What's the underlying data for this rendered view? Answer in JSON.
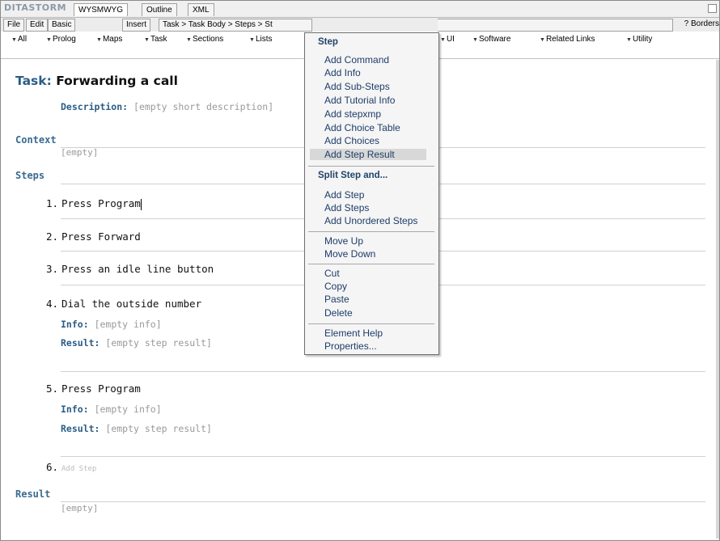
{
  "app": {
    "logo": "DITASTORM"
  },
  "tabs": [
    {
      "label": "WYSMWYG",
      "active": true
    },
    {
      "label": "Outline",
      "active": false
    },
    {
      "label": "XML",
      "active": false
    }
  ],
  "toolbar": {
    "file": "File",
    "edit": "Edit",
    "basic": "Basic",
    "insert": "Insert",
    "breadcrumb": "Task > Task Body > Steps > St",
    "borders": "? Borders"
  },
  "dropdowns": {
    "all": "All",
    "prolog": "Prolog",
    "maps": "Maps",
    "task": "Task",
    "sections": "Sections",
    "lists": "Lists",
    "ui": "UI",
    "software": "Software",
    "related_links": "Related Links",
    "utility": "Utility"
  },
  "doc": {
    "task_label": "Task:",
    "task_title": "Forwarding a call",
    "description_label": "Description:",
    "description_value": "[empty short description]",
    "context_label": "Context",
    "context_value": "[empty]",
    "steps_label": "Steps",
    "steps": [
      {
        "num": "1.",
        "text": "Press Program"
      },
      {
        "num": "2.",
        "text": "Press Forward"
      },
      {
        "num": "3.",
        "text": "Press an idle line button"
      },
      {
        "num": "4.",
        "text": "Dial the outside number",
        "info_label": "Info:",
        "info_value": "[empty info]",
        "result_label": "Result:",
        "result_value": "[empty step result]"
      },
      {
        "num": "5.",
        "text": "Press Program",
        "info_label": "Info:",
        "info_value": "[empty info]",
        "result_label": "Result:",
        "result_value": "[empty step result]"
      },
      {
        "num": "6.",
        "text": "Add Step"
      }
    ],
    "result_label": "Result",
    "result_value": "[empty]"
  },
  "menu": {
    "header_step": "Step",
    "add_command": "Add Command",
    "add_info": "Add Info",
    "add_substeps": "Add Sub-Steps",
    "add_tutorial_info": "Add Tutorial Info",
    "add_stepxmp": "Add stepxmp",
    "add_choice_table": "Add Choice Table",
    "add_choices": "Add Choices",
    "add_step_result": "Add Step Result",
    "header_split": "Split Step and...",
    "add_step": "Add Step",
    "add_steps": "Add Steps",
    "add_unordered_steps": "Add Unordered Steps",
    "move_up": "Move Up",
    "move_down": "Move Down",
    "cut": "Cut",
    "copy": "Copy",
    "paste": "Paste",
    "delete": "Delete",
    "element_help": "Element Help",
    "properties": "Properties..."
  },
  "colors": {
    "label_blue": "#2a5d86",
    "menu_text": "#1d3c68",
    "highlight": "#d8d8d8"
  }
}
